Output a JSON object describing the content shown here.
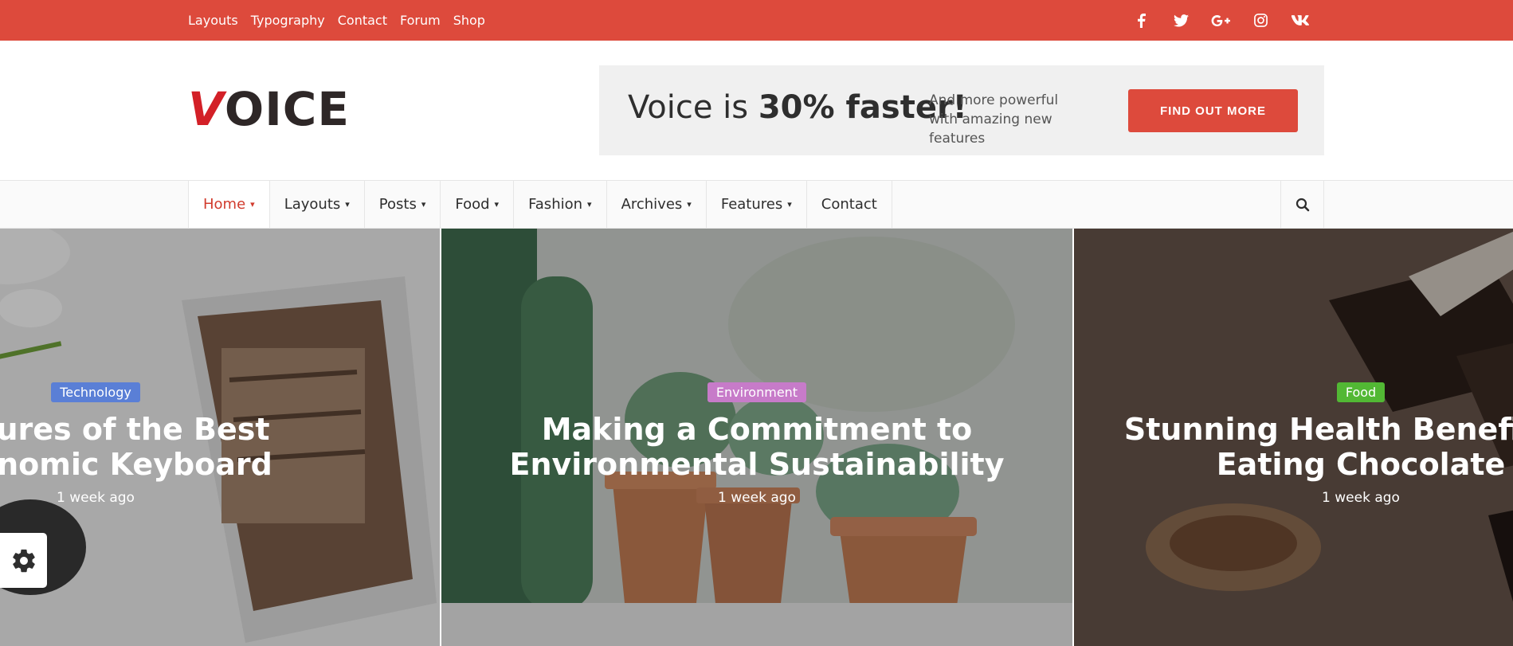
{
  "topbar": {
    "links": [
      "Layouts",
      "Typography",
      "Contact",
      "Forum",
      "Shop"
    ],
    "social_icons": [
      "facebook-icon",
      "twitter-icon",
      "google-plus-icon",
      "instagram-icon",
      "vk-icon"
    ]
  },
  "logo": {
    "first": "V",
    "rest": "OICE"
  },
  "banner": {
    "headline_prefix": "Voice is ",
    "headline_bold": "30% faster!",
    "subtext": "And more powerful with amazing new features",
    "cta": "FIND OUT MORE"
  },
  "nav": {
    "items": [
      {
        "label": "Home",
        "dropdown": true,
        "active": true
      },
      {
        "label": "Layouts",
        "dropdown": true
      },
      {
        "label": "Posts",
        "dropdown": true
      },
      {
        "label": "Food",
        "dropdown": true
      },
      {
        "label": "Fashion",
        "dropdown": true
      },
      {
        "label": "Archives",
        "dropdown": true
      },
      {
        "label": "Features",
        "dropdown": true
      },
      {
        "label": "Contact",
        "dropdown": false
      }
    ],
    "search_icon": "search-icon"
  },
  "slides": [
    {
      "category": "Technology",
      "category_color": "#5a7fd6",
      "title_line1": "Features of the Best",
      "title_line2": "Ergonomic Keyboard",
      "time": "1 week ago"
    },
    {
      "category": "Environment",
      "category_color": "#c77bc9",
      "title_line1": "Making a Commitment to",
      "title_line2": "Environmental Sustainability",
      "time": "1 week ago"
    },
    {
      "category": "Food",
      "category_color": "#52b834",
      "title_line1": "Stunning Health Benefits of",
      "title_line2": "Eating Chocolate",
      "time": "1 week ago"
    }
  ],
  "settings_icon": "gear-icon",
  "colors": {
    "accent": "#dd4a3c"
  }
}
